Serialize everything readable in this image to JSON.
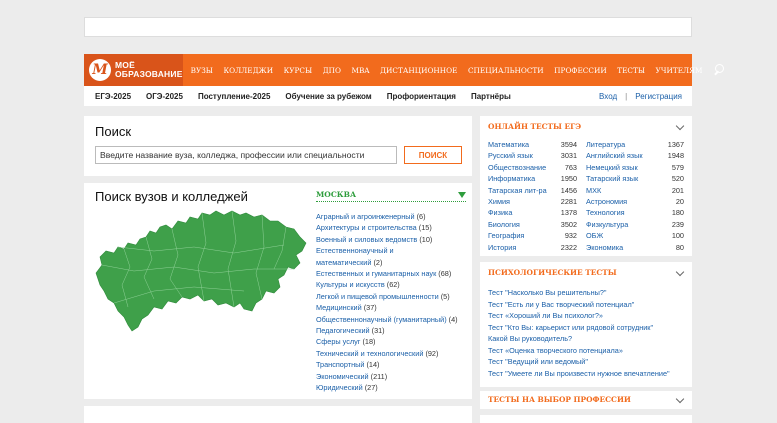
{
  "logo": {
    "mark": "M",
    "line1": "МОЁ",
    "line2": "ОБРАЗОВАНИЕ"
  },
  "nav": [
    "ВУЗЫ",
    "КОЛЛЕДЖИ",
    "КУРСЫ",
    "ДПО",
    "MBA",
    "ДИСТАНЦИОННОЕ",
    "СПЕЦИАЛЬНОСТИ",
    "ПРОФЕССИИ",
    "ТЕСТЫ",
    "УЧИТЕЛЯМ"
  ],
  "subnav": {
    "items": [
      "ЕГЭ-2025",
      "ОГЭ-2025",
      "Поступление-2025",
      "Обучение за рубежом",
      "Профориентация",
      "Партнёры"
    ],
    "login": "Вход",
    "separator": "|",
    "register": "Регистрация"
  },
  "search": {
    "title": "Поиск",
    "placeholder": "Введите название вуза, колледжа, профессии или специальности",
    "button": "ПОИСК"
  },
  "unis": {
    "title": "Поиск вузов и колледжей",
    "city": "МОСКВА",
    "categories": [
      {
        "name": "Аграрный и агроинженерный",
        "count": "(6)"
      },
      {
        "name": "Архитектуры и строительства",
        "count": "(15)"
      },
      {
        "name": "Военный и силовых ведомств",
        "count": "(10)"
      },
      {
        "name": "Естественнонаучный и",
        "count": ""
      },
      {
        "name": "математический",
        "count": "(2)"
      },
      {
        "name": "Естественных и гуманитарных наук",
        "count": "(68)"
      },
      {
        "name": "Культуры и искусств",
        "count": "(62)"
      },
      {
        "name": "Легкой и пищевой промышленности",
        "count": "(5)"
      },
      {
        "name": "Медицинский",
        "count": "(37)"
      },
      {
        "name": "Общественнонаучный (гуманитарный)",
        "count": "(4)"
      },
      {
        "name": "Педагогический",
        "count": "(31)"
      },
      {
        "name": "Сферы услуг",
        "count": "(18)"
      },
      {
        "name": "Технический и технологический",
        "count": "(92)"
      },
      {
        "name": "Транспортный",
        "count": "(14)"
      },
      {
        "name": "Экономический",
        "count": "(211)"
      },
      {
        "name": "Юридический",
        "count": "(27)"
      }
    ]
  },
  "tests": {
    "title": "ОНЛАЙН ТЕСТЫ ЕГЭ",
    "rows": [
      {
        "l": "Математика",
        "lc": "3594",
        "r": "Литература",
        "rc": "1367"
      },
      {
        "l": "Русский язык",
        "lc": "3031",
        "r": "Английский язык",
        "rc": "1948"
      },
      {
        "l": "Обществознание",
        "lc": "763",
        "r": "Немецкий язык",
        "rc": "579"
      },
      {
        "l": "Информатика",
        "lc": "1950",
        "r": "Татарский язык",
        "rc": "520"
      },
      {
        "l": "Татарская лит-ра",
        "lc": "1456",
        "r": "МХК",
        "rc": "201"
      },
      {
        "l": "Химия",
        "lc": "2281",
        "r": "Астрономия",
        "rc": "20"
      },
      {
        "l": "Физика",
        "lc": "1378",
        "r": "Технология",
        "rc": "180"
      },
      {
        "l": "Биология",
        "lc": "3502",
        "r": "Физкультура",
        "rc": "239"
      },
      {
        "l": "География",
        "lc": "932",
        "r": "ОБЖ",
        "rc": "100"
      },
      {
        "l": "История",
        "lc": "2322",
        "r": "Экономика",
        "rc": "80"
      }
    ]
  },
  "psych": {
    "title": "ПСИХОЛОГИЧЕСКИЕ ТЕСТЫ",
    "items": [
      "Тест \"Насколько Вы решительны?\"",
      "Тест \"Есть ли у Вас творческий потенциал\"",
      "Тест «Хороший ли Вы психолог?»",
      "Тест \"Кто Вы: карьерист или рядовой сотрудник\"",
      "Какой Вы руководитель?",
      "Тест «Оценка творческого потенциала»",
      "Тест \"Ведущий или ведомый\"",
      "Тест \"Умеете ли Вы произвести нужное впечатление\""
    ]
  },
  "prof": {
    "title": "ТЕСТЫ НА ВЫБОР ПРОФЕССИИ"
  },
  "colors": {
    "brand": "#f26b1d",
    "link": "#1a5fa8",
    "map": "#3fa04a"
  }
}
